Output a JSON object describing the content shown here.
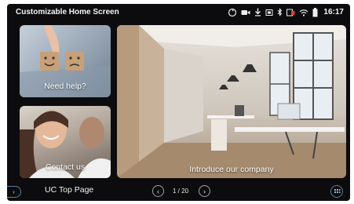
{
  "statusbar": {
    "title": "Customizable Home Screen",
    "time": "16:17",
    "icons": [
      "sync-icon",
      "video-icon",
      "download-icon",
      "cast-icon",
      "bluetooth-icon",
      "battery-alert-icon",
      "wifi-icon",
      "battery-icon"
    ]
  },
  "tiles": {
    "help": {
      "label": "Need help?"
    },
    "contact": {
      "label": "Contact us"
    },
    "company": {
      "label": "Introduce our company"
    }
  },
  "bottombar": {
    "page_name": "UC Top Page",
    "page_indicator": "1 / 20",
    "prev_symbol": "‹",
    "next_symbol": "›",
    "edge_symbol": "›"
  }
}
